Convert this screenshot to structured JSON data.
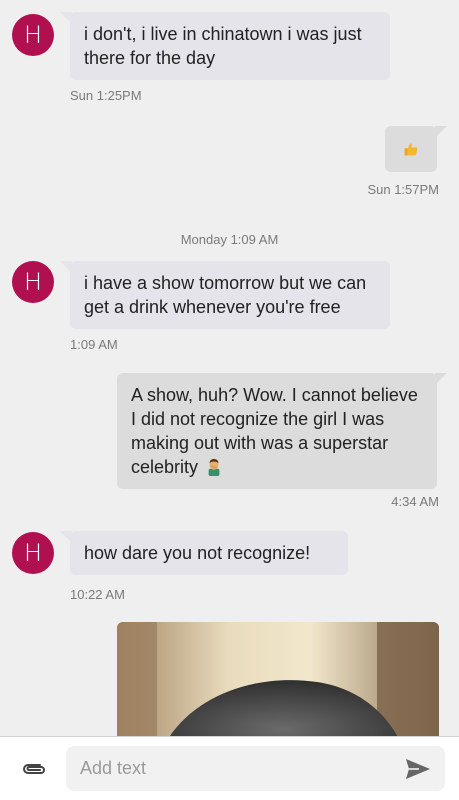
{
  "contact": {
    "initial": "H",
    "color": "#b0104f"
  },
  "messages": [
    {
      "direction": "incoming",
      "text": "i don't, i live in chinatown i was just there for the day",
      "time": "Sun 1:25PM"
    },
    {
      "direction": "outgoing",
      "emoji": "thumbs-up-icon",
      "time": "Sun 1:57PM"
    },
    {
      "direction": "divider",
      "text": "Monday 1:09 AM"
    },
    {
      "direction": "incoming",
      "text": "i have a show tomorrow but we can get a drink whenever you're free",
      "time": "1:09 AM"
    },
    {
      "direction": "outgoing",
      "text": "A show, huh? Wow. I cannot believe I did not recognize the girl I was making out with was a superstar celebrity",
      "emoji": "man-facepalming-icon",
      "time": "4:34 AM"
    },
    {
      "direction": "incoming",
      "text": "how dare you not recognize!",
      "time": "10:22 AM"
    },
    {
      "direction": "outgoing",
      "attachment": "photo-attachment"
    }
  ],
  "composer": {
    "placeholder": "Add text",
    "attach_icon": "paperclip-icon",
    "send_icon": "send-icon"
  }
}
